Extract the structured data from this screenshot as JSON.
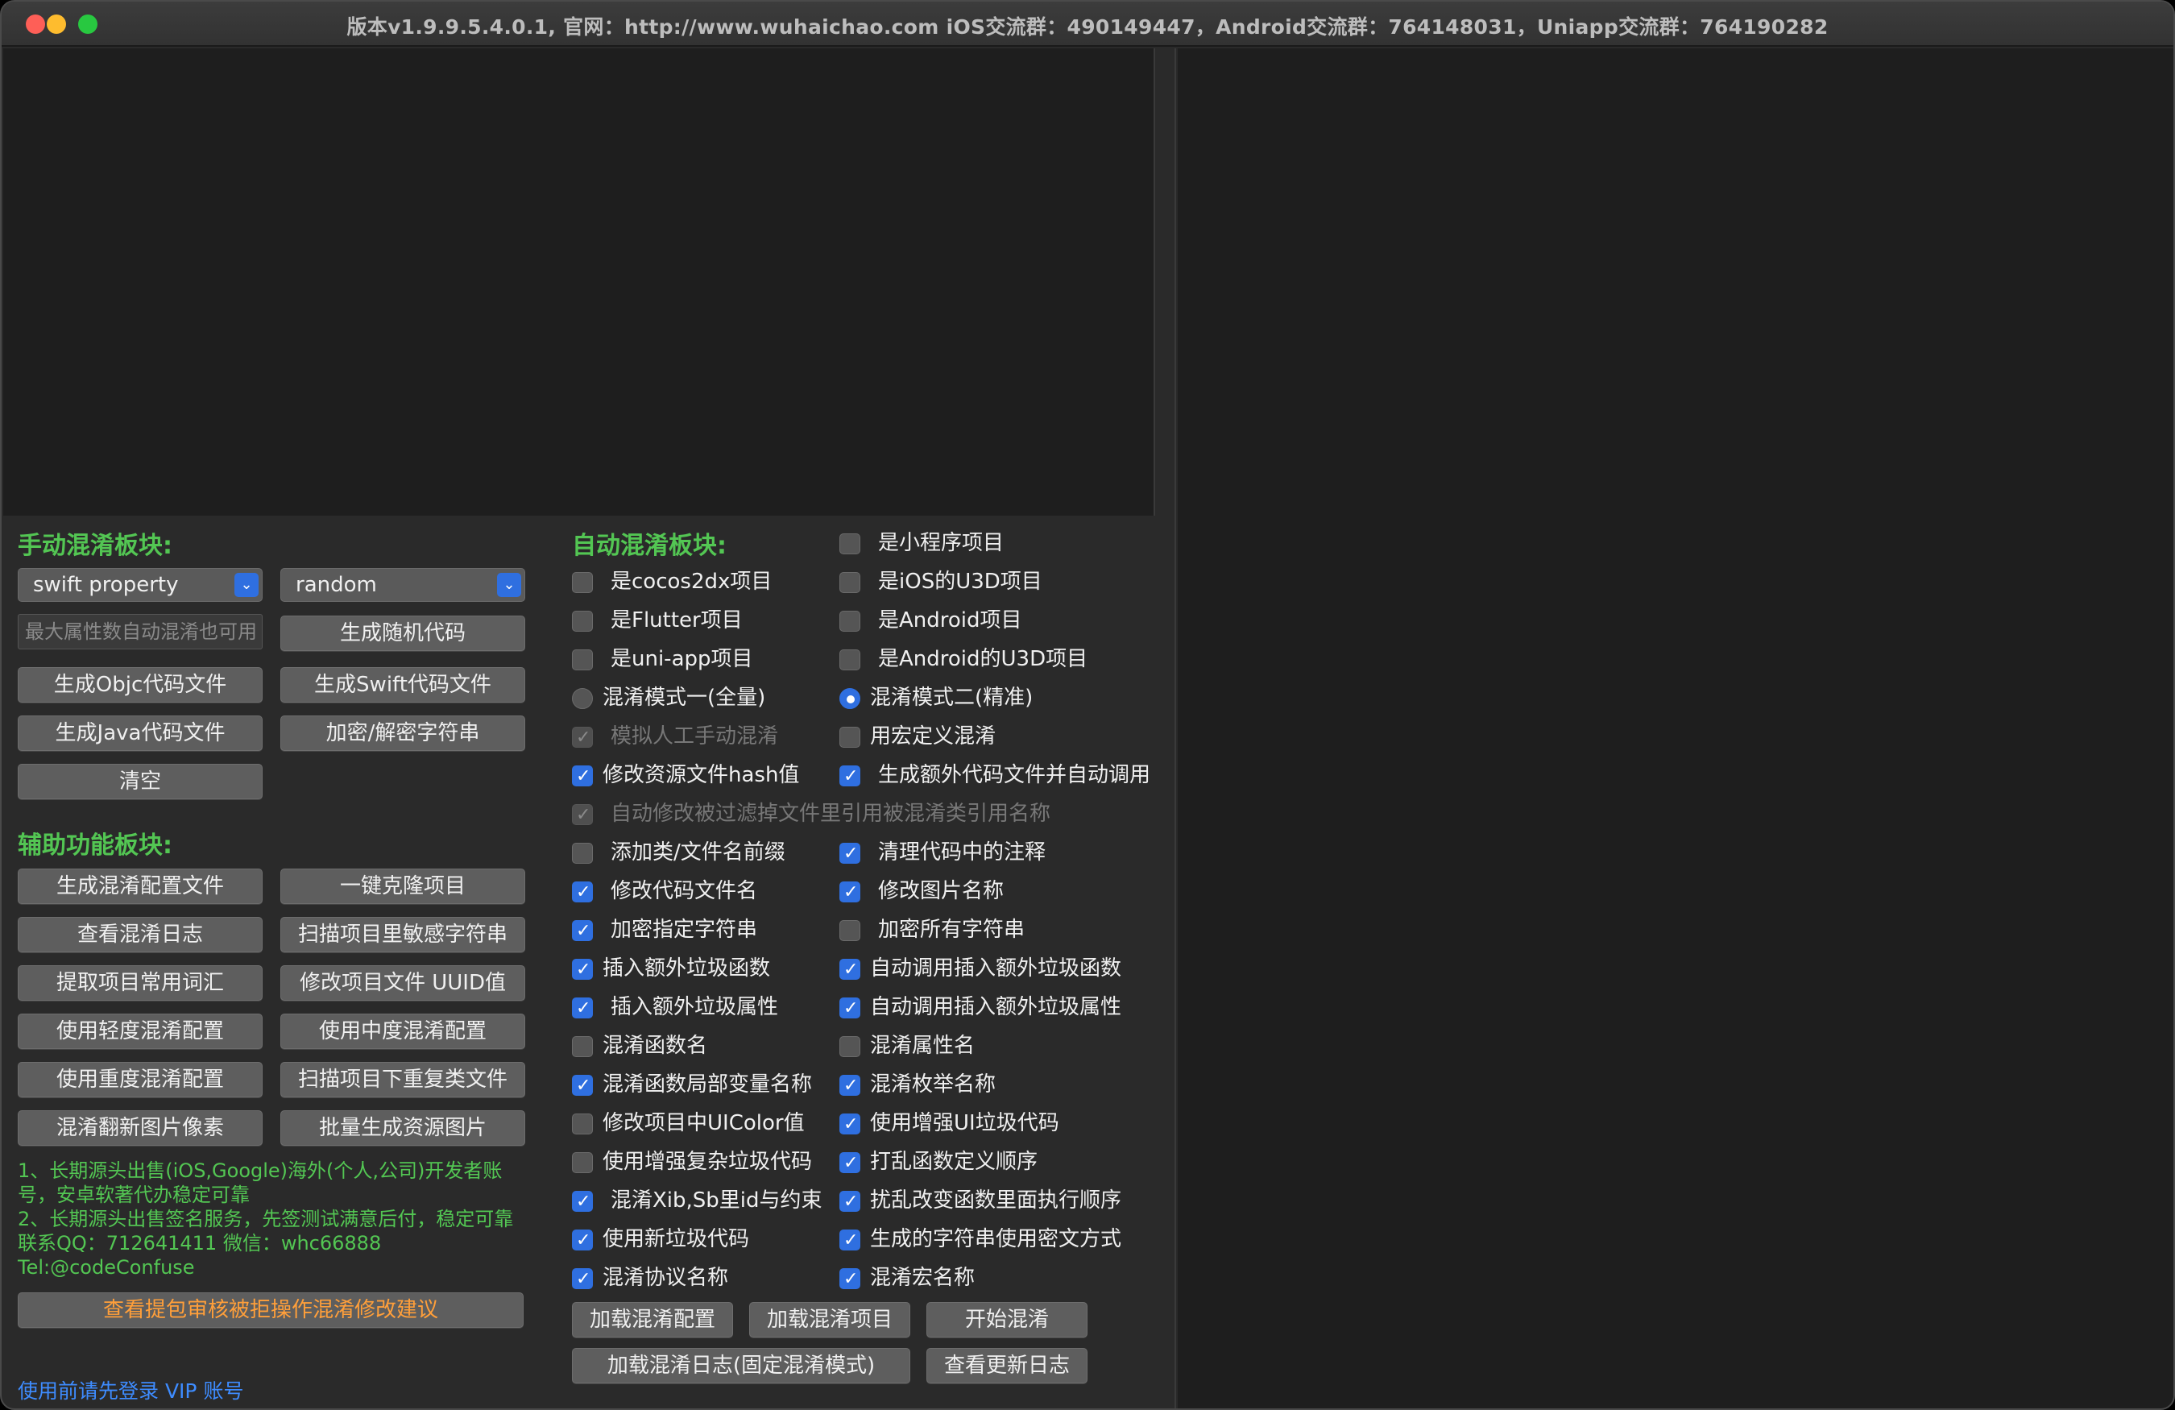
{
  "window": {
    "title": "版本v1.9.9.5.4.0.1, 官网：http://www.wuhaichao.com iOS交流群：490149447，Android交流群：764148031，Uniapp交流群：764190282"
  },
  "manual": {
    "heading": "手动混淆板块:",
    "select_type": "swift property",
    "select_mode": "random",
    "max_props_placeholder": "最大属性数自动混淆也可用",
    "buttons": {
      "gen_random": "生成随机代码",
      "gen_objc": "生成Objc代码文件",
      "gen_swift": "生成Swift代码文件",
      "gen_java": "生成Java代码文件",
      "encrypt": "加密/解密字符串",
      "clear": "清空"
    }
  },
  "aux": {
    "heading": "辅助功能板块:",
    "buttons": {
      "gen_config": "生成混淆配置文件",
      "clone": "一键克隆项目",
      "view_log": "查看混淆日志",
      "scan_sensitive": "扫描项目里敏感字符串",
      "extract_words": "提取项目常用词汇",
      "modify_uuid": "修改项目文件 UUID值",
      "light_config": "使用轻度混淆配置",
      "medium_config": "使用中度混淆配置",
      "heavy_config": "使用重度混淆配置",
      "scan_dup": "扫描项目下重复类文件",
      "flip_pixels": "混淆翻新图片像素",
      "batch_images": "批量生成资源图片"
    },
    "notes": [
      "1、长期源头出售(iOS,Google)海外(个人,公司)开发者账",
      "号，安卓软著代办稳定可靠",
      "2、长期源头出售签名服务，先签测试满意后付，稳定可靠",
      "联系QQ：712641411 微信：whc66888",
      "Tel:@codeConfuse"
    ],
    "review_button": "查看提包审核被拒操作混淆修改建议",
    "vip_link": "使用前请先登录 VIP 账号"
  },
  "auto": {
    "heading": "自动混淆板块:",
    "options": {
      "mini_program": "是小程序项目",
      "cocos2dx": "是cocos2dx项目",
      "ios_u3d": "是iOS的U3D项目",
      "flutter": "是Flutter项目",
      "android": "是Android项目",
      "uniapp": "是uni-app项目",
      "android_u3d": "是Android的U3D项目",
      "mode_full": "混淆模式一(全量)",
      "mode_precise": "混淆模式二(精准)",
      "simulate_manual": "模拟人工手动混淆",
      "macro_custom": "用宏定义混淆",
      "hash_resource": "修改资源文件hash值",
      "extra_code_files": "生成额外代码文件并自动调用",
      "auto_modify_filtered": "自动修改被过滤掉文件里引用被混淆类引用名称",
      "add_prefix": "添加类/文件名前缀",
      "clean_comments": "清理代码中的注释",
      "rename_code_files": "修改代码文件名",
      "rename_images": "修改图片名称",
      "encrypt_specified": "加密指定字符串",
      "encrypt_all": "加密所有字符串",
      "insert_junk_funcs": "插入额外垃圾函数",
      "auto_call_junk_funcs": "自动调用插入额外垃圾函数",
      "insert_junk_props": "插入额外垃圾属性",
      "auto_call_junk_props": "自动调用插入额外垃圾属性",
      "obf_func_names": "混淆函数名",
      "obf_prop_names": "混淆属性名",
      "obf_local_vars": "混淆函数局部变量名称",
      "obf_enum_names": "混淆枚举名称",
      "modify_uicolor": "修改项目中UIColor值",
      "enhanced_ui_junk": "使用增强UI垃圾代码",
      "enhanced_complex_junk": "使用增强复杂垃圾代码",
      "shuffle_func_order": "打乱函数定义顺序",
      "obf_xib_ids": "混淆Xib,Sb里id与约束",
      "shuffle_exec_order": "扰乱改变函数里面执行顺序",
      "new_junk_code": "使用新垃圾代码",
      "cipher_strings": "生成的字符串使用密文方式",
      "obf_protocol_names": "混淆协议名称",
      "obf_macro_names": "混淆宏名称"
    },
    "buttons": {
      "load_config": "加载混淆配置",
      "load_project": "加载混淆项目",
      "start": "开始混淆",
      "load_log_fixed": "加载混淆日志(固定混淆模式)",
      "view_update_log": "查看更新日志"
    }
  },
  "colors": {
    "accent_green": "#53c653",
    "accent_blue": "#2f6fe0",
    "orange": "#ff9f3a",
    "link_blue": "#3e8cff"
  }
}
